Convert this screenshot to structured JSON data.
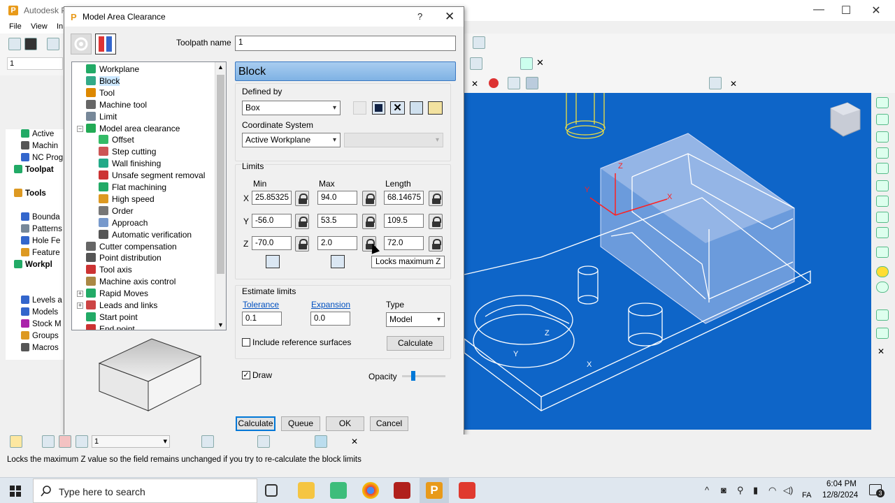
{
  "app": {
    "title": "Autodesk P",
    "menu": [
      "File",
      "View",
      "In"
    ],
    "toolpath_field": "1",
    "left_tree": [
      "Active",
      "Machin",
      "NC Prog",
      "Toolpat",
      "Tools",
      "Bounda",
      "Patterns",
      "Hole Fe",
      "Feature",
      "Workpl",
      "Levels a",
      "Models",
      "Stock M",
      "Groups",
      "Macros"
    ]
  },
  "dialog": {
    "title": "Model Area Clearance",
    "help": "?",
    "close": "✕",
    "toolpath_name_label": "Toolpath name",
    "toolpath_name_value": "1",
    "tree": [
      {
        "label": "Workplane",
        "indent": 0
      },
      {
        "label": "Block",
        "indent": 0,
        "selected": true
      },
      {
        "label": "Tool",
        "indent": 0
      },
      {
        "label": "Machine tool",
        "indent": 0
      },
      {
        "label": "Limit",
        "indent": 0
      },
      {
        "label": "Model area clearance",
        "indent": 0,
        "expander": "−"
      },
      {
        "label": "Offset",
        "indent": 1
      },
      {
        "label": "Step cutting",
        "indent": 1
      },
      {
        "label": "Wall finishing",
        "indent": 1
      },
      {
        "label": "Unsafe segment removal",
        "indent": 1
      },
      {
        "label": "Flat machining",
        "indent": 1
      },
      {
        "label": "High speed",
        "indent": 1
      },
      {
        "label": "Order",
        "indent": 1
      },
      {
        "label": "Approach",
        "indent": 1
      },
      {
        "label": "Automatic verification",
        "indent": 1
      },
      {
        "label": "Cutter compensation",
        "indent": 0
      },
      {
        "label": "Point distribution",
        "indent": 0
      },
      {
        "label": "Tool axis",
        "indent": 0
      },
      {
        "label": "Machine axis control",
        "indent": 0
      },
      {
        "label": "Rapid Moves",
        "indent": 0,
        "expander": "+"
      },
      {
        "label": "Leads and links",
        "indent": 0,
        "expander": "+"
      },
      {
        "label": "Start point",
        "indent": 0
      },
      {
        "label": "End point",
        "indent": 0
      }
    ],
    "panel_title": "Block",
    "defined_by_label": "Defined by",
    "defined_by_value": "Box",
    "coord_system_label": "Coordinate System",
    "coord_system_value": "Active Workplane",
    "limits_label": "Limits",
    "col_min": "Min",
    "col_max": "Max",
    "col_length": "Length",
    "limits": {
      "x": {
        "label": "X",
        "min": "25.85325",
        "max": "94.0",
        "length": "68.14675"
      },
      "y": {
        "label": "Y",
        "min": "-56.0",
        "max": "53.5",
        "length": "109.5"
      },
      "z": {
        "label": "Z",
        "min": "-70.0",
        "max": "2.0",
        "length": "72.0"
      }
    },
    "tooltip": "Locks maximum Z",
    "estimate_label": "Estimate limits",
    "tolerance_label": "Tolerance",
    "tolerance_value": "0.1",
    "expansion_label": "Expansion",
    "expansion_value": "0.0",
    "type_label": "Type",
    "type_value": "Model",
    "include_ref_label": "Include reference surfaces",
    "include_ref_checked": false,
    "calculate_small": "Calculate",
    "draw_label": "Draw",
    "draw_checked": true,
    "opacity_label": "Opacity",
    "opacity_level": 0.25,
    "buttons": {
      "calculate": "Calculate",
      "queue": "Queue",
      "ok": "OK",
      "cancel": "Cancel"
    }
  },
  "bottom_toolbar": {
    "value": "1"
  },
  "status_text": "Locks the maximum Z value so the field remains unchanged if you try to re-calculate the block limits",
  "taskbar": {
    "search_placeholder": "Type here to search",
    "time": "6:04 PM",
    "date": "12/8/2024",
    "lang": "FA",
    "notifications": "3"
  },
  "colors": {
    "accent": "#0078d7",
    "viewport": "#0e65c8",
    "panel_header": "#8fbce6"
  }
}
